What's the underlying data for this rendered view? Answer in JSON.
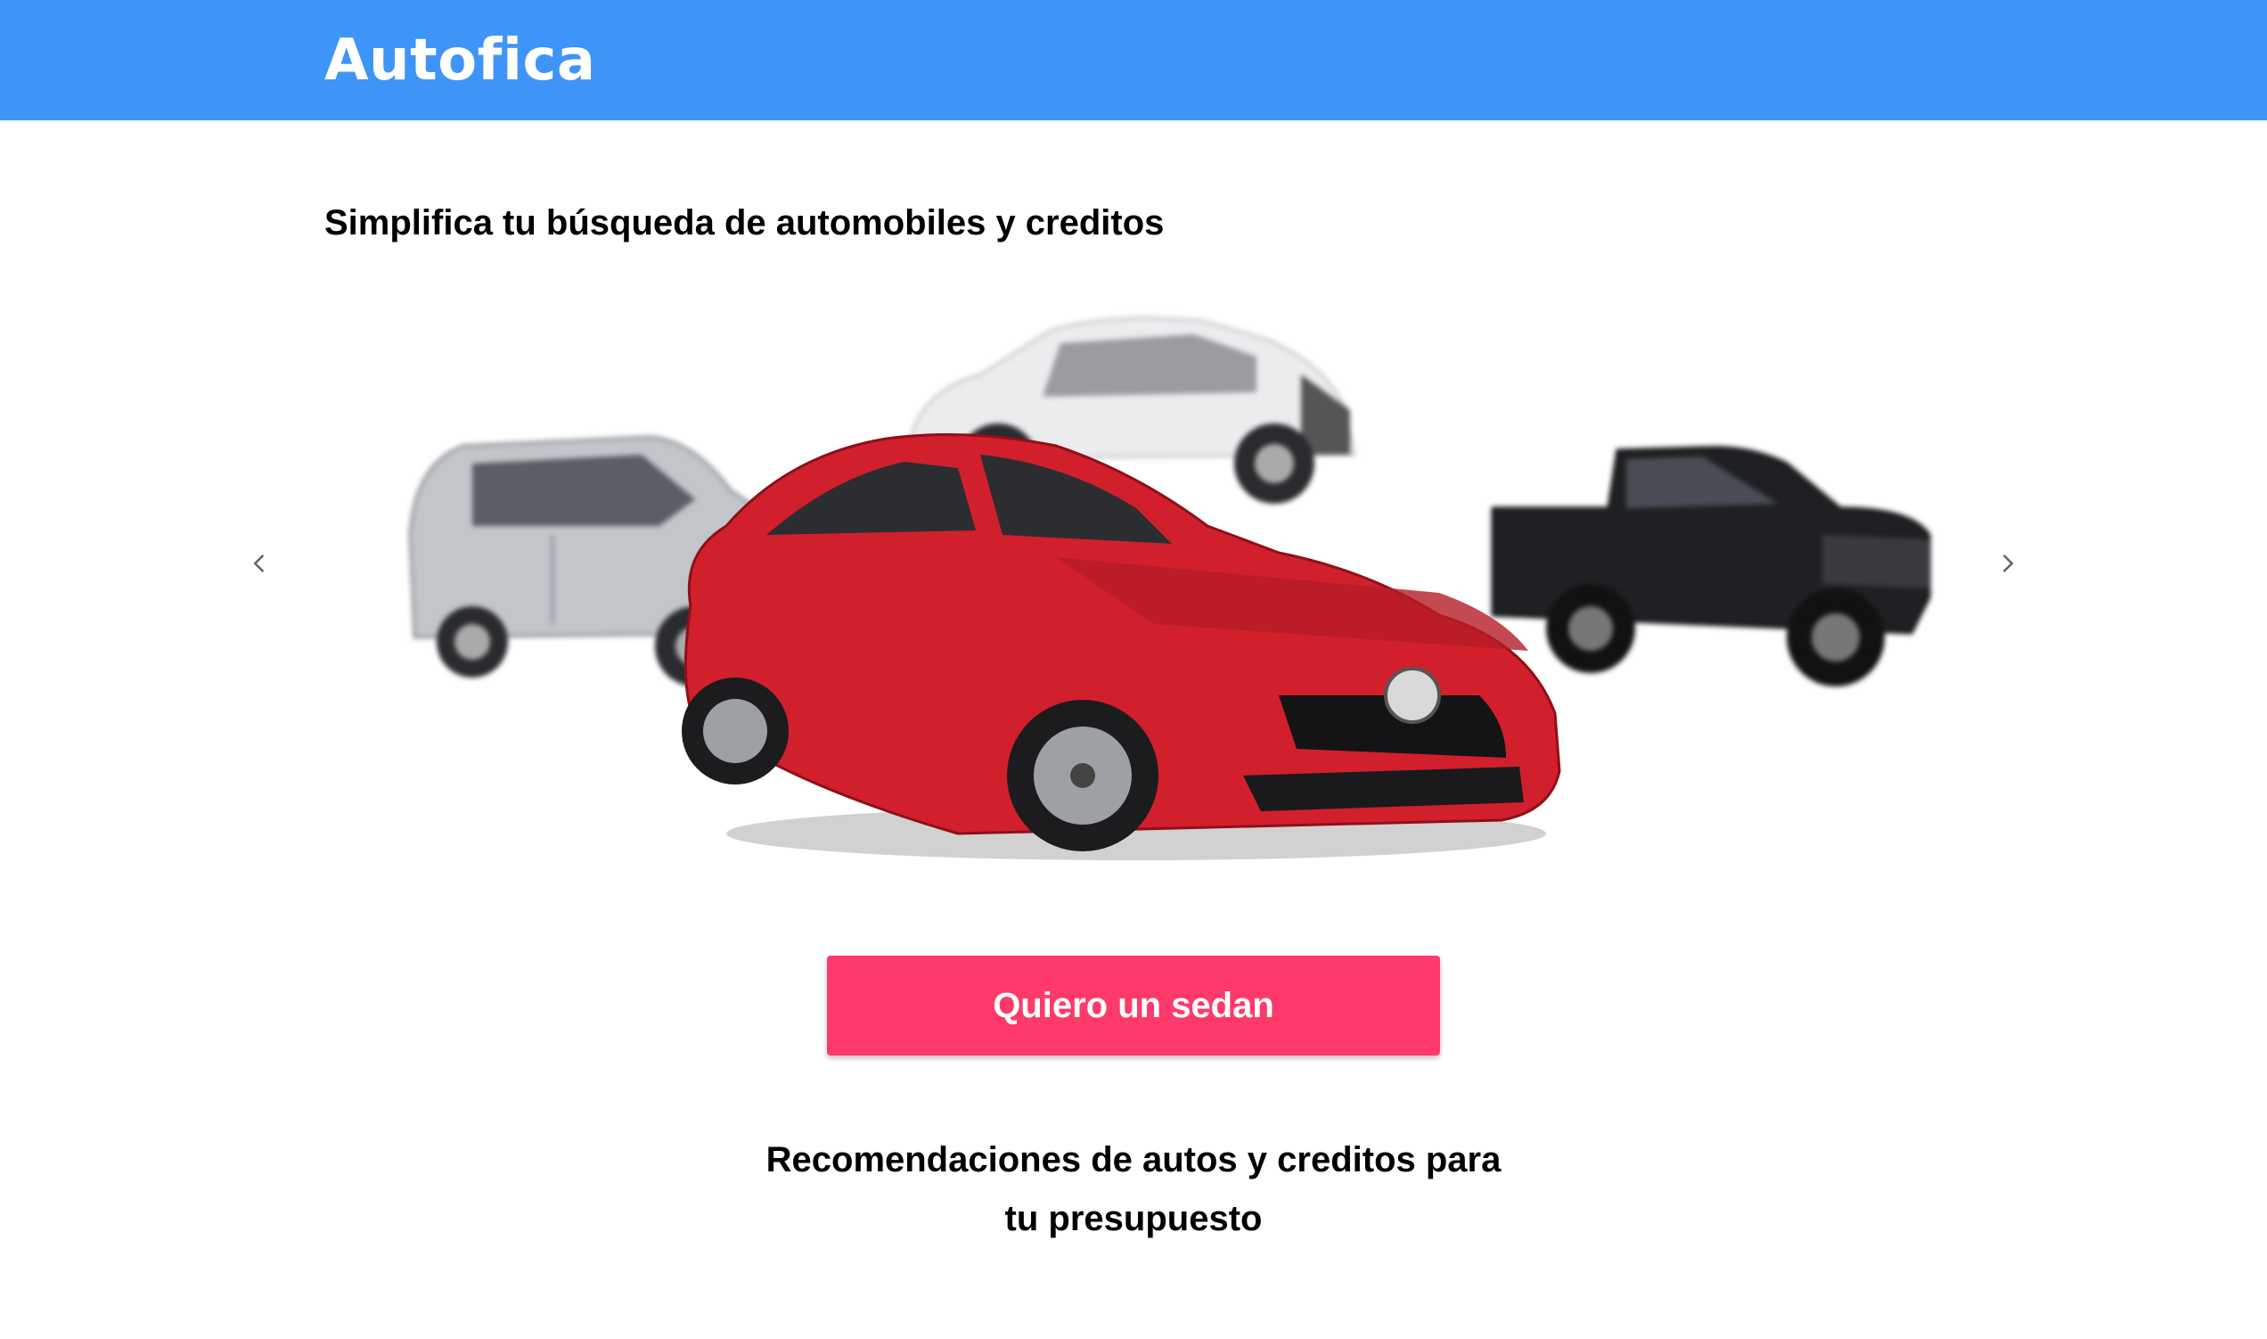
{
  "header": {
    "brand": "Autofica",
    "background_color": "#3f94f8"
  },
  "hero": {
    "tagline": "Simplifica tu búsqueda de automobiles y creditos"
  },
  "carousel": {
    "prev_icon": "chevron-left-icon",
    "next_icon": "chevron-right-icon",
    "items": [
      {
        "name": "minivan",
        "color": "#b9bcc1"
      },
      {
        "name": "suv",
        "color": "#e8e8ea"
      },
      {
        "name": "sedan",
        "color": "#d7232f"
      },
      {
        "name": "pickup",
        "color": "#1d1e21"
      }
    ]
  },
  "cta": {
    "label": "Quiero un sedan",
    "color": "#fd3a69"
  },
  "recommendations": {
    "line1": "Recomendaciones de autos y creditos para",
    "line2": "tu presupuesto"
  }
}
